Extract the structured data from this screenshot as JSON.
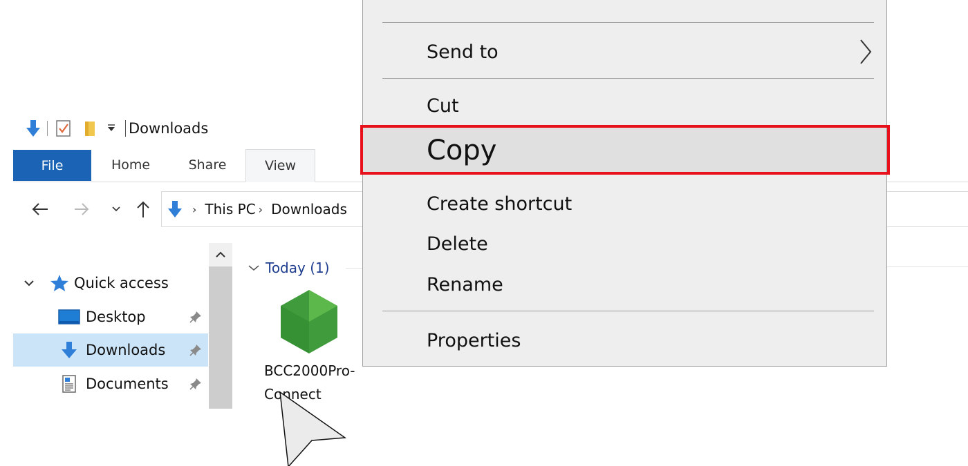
{
  "window": {
    "title": "Downloads"
  },
  "ribbon": {
    "tabs": [
      "File",
      "Home",
      "Share",
      "View"
    ],
    "active_tab": "View"
  },
  "address_bar": {
    "crumbs": [
      "This PC",
      "Downloads"
    ]
  },
  "nav_pane": {
    "quick_access_label": "Quick access",
    "items": [
      {
        "label": "Desktop",
        "icon": "desktop-icon",
        "pinned": true
      },
      {
        "label": "Downloads",
        "icon": "download-arrow-icon",
        "pinned": true,
        "selected": true
      },
      {
        "label": "Documents",
        "icon": "documents-icon",
        "pinned": true
      }
    ]
  },
  "content": {
    "group_label": "Today (1)",
    "file": {
      "name": "BCC2000Pro-Connect",
      "icon": "nodejs-hexagon-icon"
    }
  },
  "context_menu": {
    "items": [
      {
        "label": "Send to",
        "has_submenu": true
      },
      {
        "label": "Cut"
      },
      {
        "label": "Copy",
        "highlighted": true
      },
      {
        "label": "Create shortcut"
      },
      {
        "label": "Delete"
      },
      {
        "label": "Rename"
      },
      {
        "label": "Properties"
      }
    ]
  },
  "colors": {
    "file_tab": "#1a63b5",
    "selection": "#cce4f7",
    "menu_bg": "#eeeeee",
    "highlight_border": "#e8111b",
    "group_label": "#1e3d8f",
    "download_arrow": "#2f7fd8",
    "nodejs_green": "#3f9b3c"
  }
}
